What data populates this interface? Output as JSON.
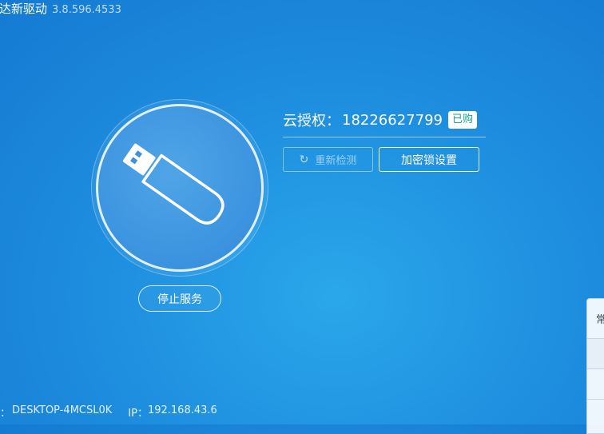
{
  "app": {
    "title": "达新驱动",
    "version": "3.8.596.4533"
  },
  "usb": {
    "icon": "usb-drive-icon",
    "stop_label": "停止服务"
  },
  "auth": {
    "label": "云授权：",
    "number": "18226627799",
    "badge": "已购",
    "badge_color": "#15a58a"
  },
  "actions": {
    "recheck_icon": "refresh-icon",
    "recheck_label": "重新检测",
    "lock_settings_label": "加密锁设置"
  },
  "footer": {
    "host_prefix": "：",
    "host": "DESKTOP-4MCSL0K",
    "ip_label": "IP：",
    "ip": "192.168.43.6"
  },
  "side_panel": {
    "first_tab": "常"
  },
  "colors": {
    "background": "#1f8fdf",
    "accent": "#ffffff"
  }
}
